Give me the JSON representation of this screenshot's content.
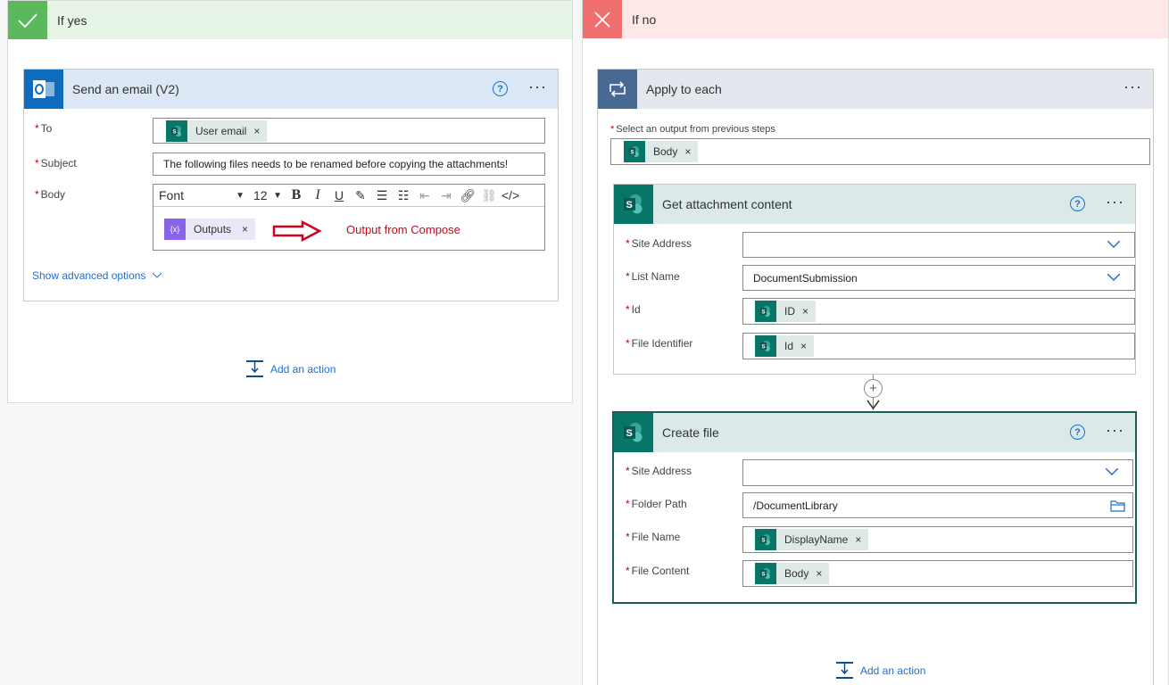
{
  "yes_branch": {
    "title": "If yes",
    "email_card": {
      "title": "Send an email (V2)",
      "to_label": "To",
      "to_token": "User email",
      "subject_label": "Subject",
      "subject_value": "The following files needs to be renamed before copying the attachments!",
      "body_label": "Body",
      "font_label": "Font",
      "font_size": "12",
      "body_token": "Outputs",
      "annotation": "Output from Compose",
      "advanced": "Show advanced options"
    },
    "add_action": "Add an action"
  },
  "no_branch": {
    "title": "If no",
    "apply_card": {
      "title": "Apply to each",
      "select_label": "Select an output from previous steps",
      "select_token": "Body"
    },
    "get_card": {
      "title": "Get attachment content",
      "site_label": "Site Address",
      "site_value": "",
      "list_label": "List Name",
      "list_value": "DocumentSubmission",
      "id_label": "Id",
      "id_token": "ID",
      "file_id_label": "File Identifier",
      "file_id_token": "Id"
    },
    "create_card": {
      "title": "Create file",
      "site_label": "Site Address",
      "site_value": "",
      "folder_label": "Folder Path",
      "folder_value": "/DocumentLibrary",
      "name_label": "File Name",
      "name_token": "DisplayName",
      "content_label": "File Content",
      "content_token": "Body"
    },
    "add_action": "Add an action"
  },
  "colors": {
    "yes_accent": "#5cb85c",
    "no_accent": "#f07070",
    "outlook_blue": "#0f6cbd",
    "loop_blue": "#486991",
    "sharepoint_teal": "#077568",
    "link_blue": "#1f6fd0",
    "annotation_red": "#d0021b"
  }
}
